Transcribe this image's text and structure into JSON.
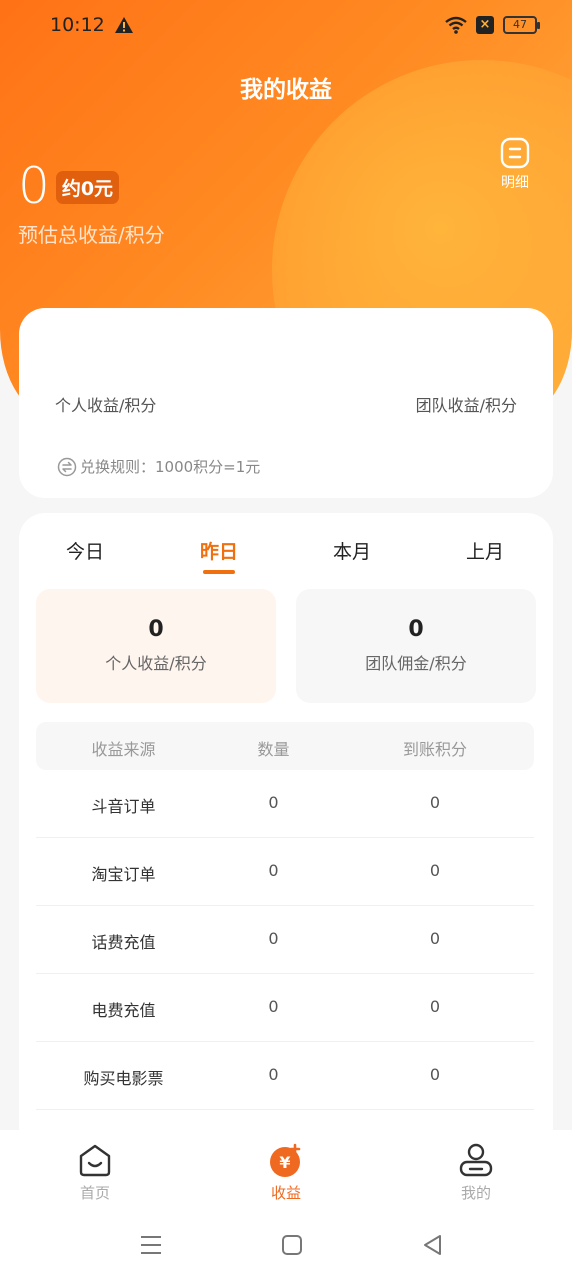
{
  "status_bar": {
    "time": "10:12",
    "battery": "47",
    "icons": [
      "warning-icon",
      "wifi-icon",
      "close-box-icon",
      "battery-icon"
    ]
  },
  "header": {
    "title": "我的收益",
    "detail_label": "明细"
  },
  "summary": {
    "total_value": "0",
    "approx": "约0元",
    "total_label": "预估总收益/积分",
    "personal_label": "个人收益/积分",
    "team_label": "团队收益/积分",
    "rule": "兑换规则：1000积分=1元"
  },
  "tabs": [
    {
      "label": "今日"
    },
    {
      "label": "昨日"
    },
    {
      "label": "本月"
    },
    {
      "label": "上月"
    }
  ],
  "active_tab": "昨日",
  "stats": {
    "personal": {
      "value": "0",
      "label": "个人收益/积分"
    },
    "team": {
      "value": "0",
      "label": "团队佣金/积分"
    }
  },
  "table": {
    "headers": [
      "收益来源",
      "数量",
      "到账积分"
    ],
    "rows": [
      [
        "斗音订单",
        "0",
        "0"
      ],
      [
        "淘宝订单",
        "0",
        "0"
      ],
      [
        "话费充值",
        "0",
        "0"
      ],
      [
        "电费充值",
        "0",
        "0"
      ],
      [
        "购买电影票",
        "0",
        "0"
      ]
    ]
  },
  "bottom_nav": [
    {
      "label": "首页",
      "icon": "home-icon"
    },
    {
      "label": "收益",
      "icon": "earnings-icon"
    },
    {
      "label": "我的",
      "icon": "profile-icon"
    }
  ],
  "colors": {
    "accent": "#f07010",
    "hero_start": "#ff7216",
    "hero_end": "#ffb13b",
    "nav_active": "#ef6a20"
  }
}
